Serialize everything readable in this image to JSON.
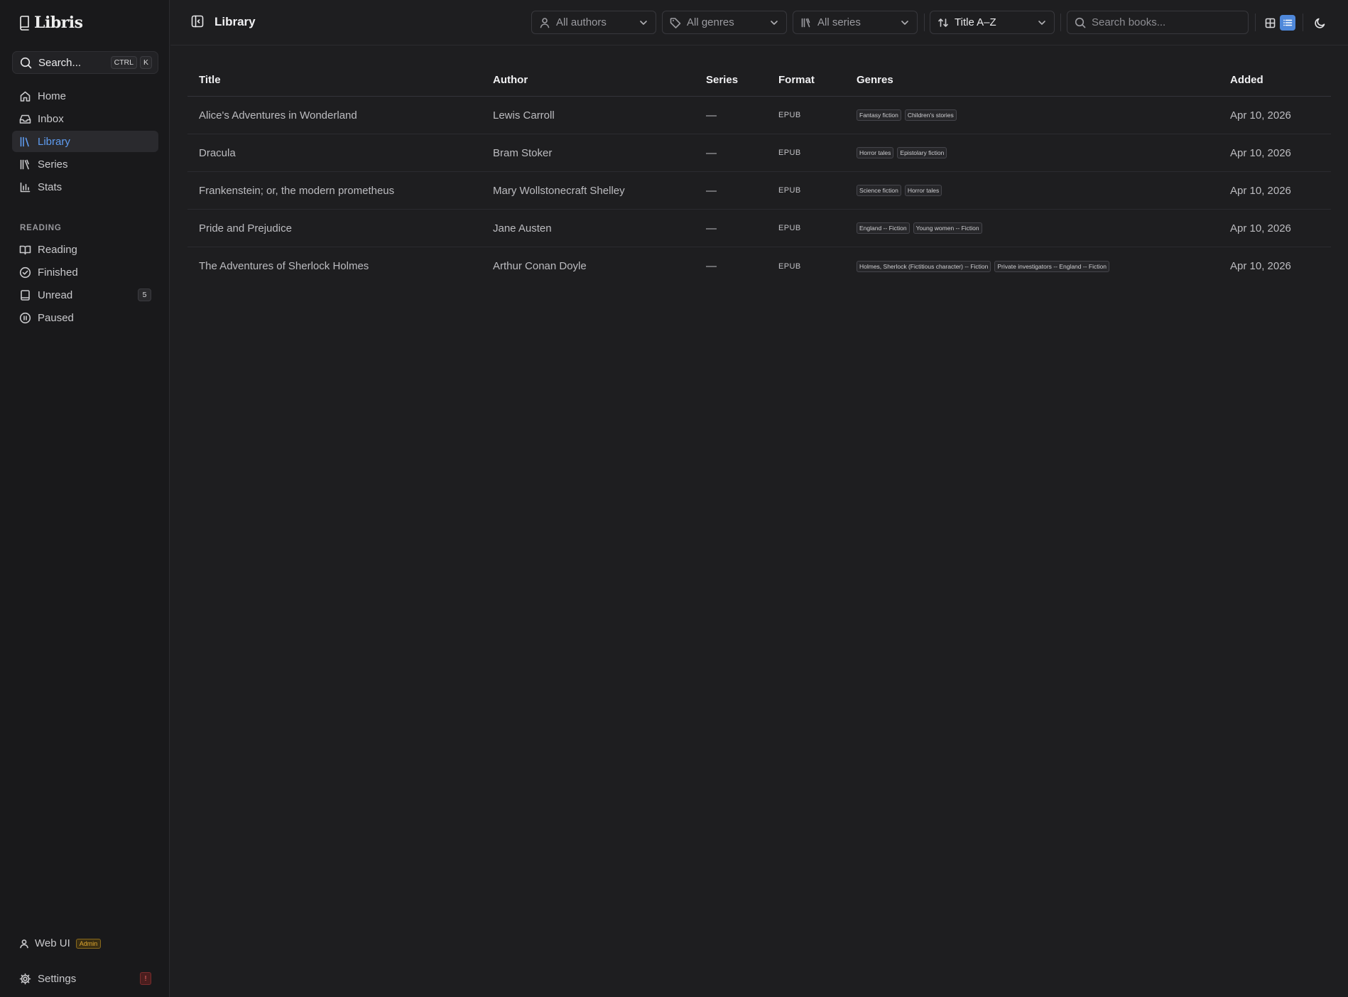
{
  "app": {
    "name": "Libris"
  },
  "sidebar": {
    "search": {
      "label": "Search...",
      "kbd": [
        "CTRL",
        "K"
      ]
    },
    "nav": [
      {
        "label": "Home",
        "icon": "home-icon"
      },
      {
        "label": "Inbox",
        "icon": "inbox-icon"
      },
      {
        "label": "Library",
        "icon": "library-icon",
        "active": true
      },
      {
        "label": "Series",
        "icon": "series-icon"
      },
      {
        "label": "Stats",
        "icon": "stats-icon"
      }
    ],
    "reading_section": {
      "title": "READING",
      "items": [
        {
          "label": "Reading",
          "icon": "book-open-icon"
        },
        {
          "label": "Finished",
          "icon": "check-circle-icon"
        },
        {
          "label": "Unread",
          "icon": "book-icon",
          "badge": "5"
        },
        {
          "label": "Paused",
          "icon": "pause-circle-icon"
        }
      ]
    },
    "user": {
      "label": "Web UI",
      "role": "Admin"
    },
    "settings": {
      "label": "Settings",
      "badge": "!"
    }
  },
  "header": {
    "title": "Library",
    "filters": {
      "authors": "All authors",
      "genres": "All genres",
      "series": "All series"
    },
    "sort": "Title A–Z",
    "search_placeholder": "Search books...",
    "view_mode": "list"
  },
  "table": {
    "columns": [
      "Title",
      "Author",
      "Series",
      "Format",
      "Genres",
      "Added"
    ],
    "rows": [
      {
        "title": "Alice's Adventures in Wonderland",
        "author": "Lewis Carroll",
        "series": "—",
        "format": "EPUB",
        "genres": [
          "Fantasy fiction",
          "Children's stories"
        ],
        "added": "Apr 10, 2026"
      },
      {
        "title": "Dracula",
        "author": "Bram Stoker",
        "series": "—",
        "format": "EPUB",
        "genres": [
          "Horror tales",
          "Epistolary fiction"
        ],
        "added": "Apr 10, 2026"
      },
      {
        "title": "Frankenstein; or, the modern prometheus",
        "author": "Mary Wollstonecraft Shelley",
        "series": "—",
        "format": "EPUB",
        "genres": [
          "Science fiction",
          "Horror tales"
        ],
        "added": "Apr 10, 2026"
      },
      {
        "title": "Pride and Prejudice",
        "author": "Jane Austen",
        "series": "—",
        "format": "EPUB",
        "genres": [
          "England -- Fiction",
          "Young women -- Fiction"
        ],
        "added": "Apr 10, 2026"
      },
      {
        "title": "The Adventures of Sherlock Holmes",
        "author": "Arthur Conan Doyle",
        "series": "—",
        "format": "EPUB",
        "genres": [
          "Holmes, Sherlock (Fictitious character) -- Fiction",
          "Private investigators -- England -- Fiction"
        ],
        "added": "Apr 10, 2026"
      }
    ]
  },
  "colors": {
    "background": "#1e1e20",
    "sidebar": "#19191b",
    "accent": "#5f9cf0",
    "admin": "#e0a830",
    "alert": "#ff6b6b"
  }
}
